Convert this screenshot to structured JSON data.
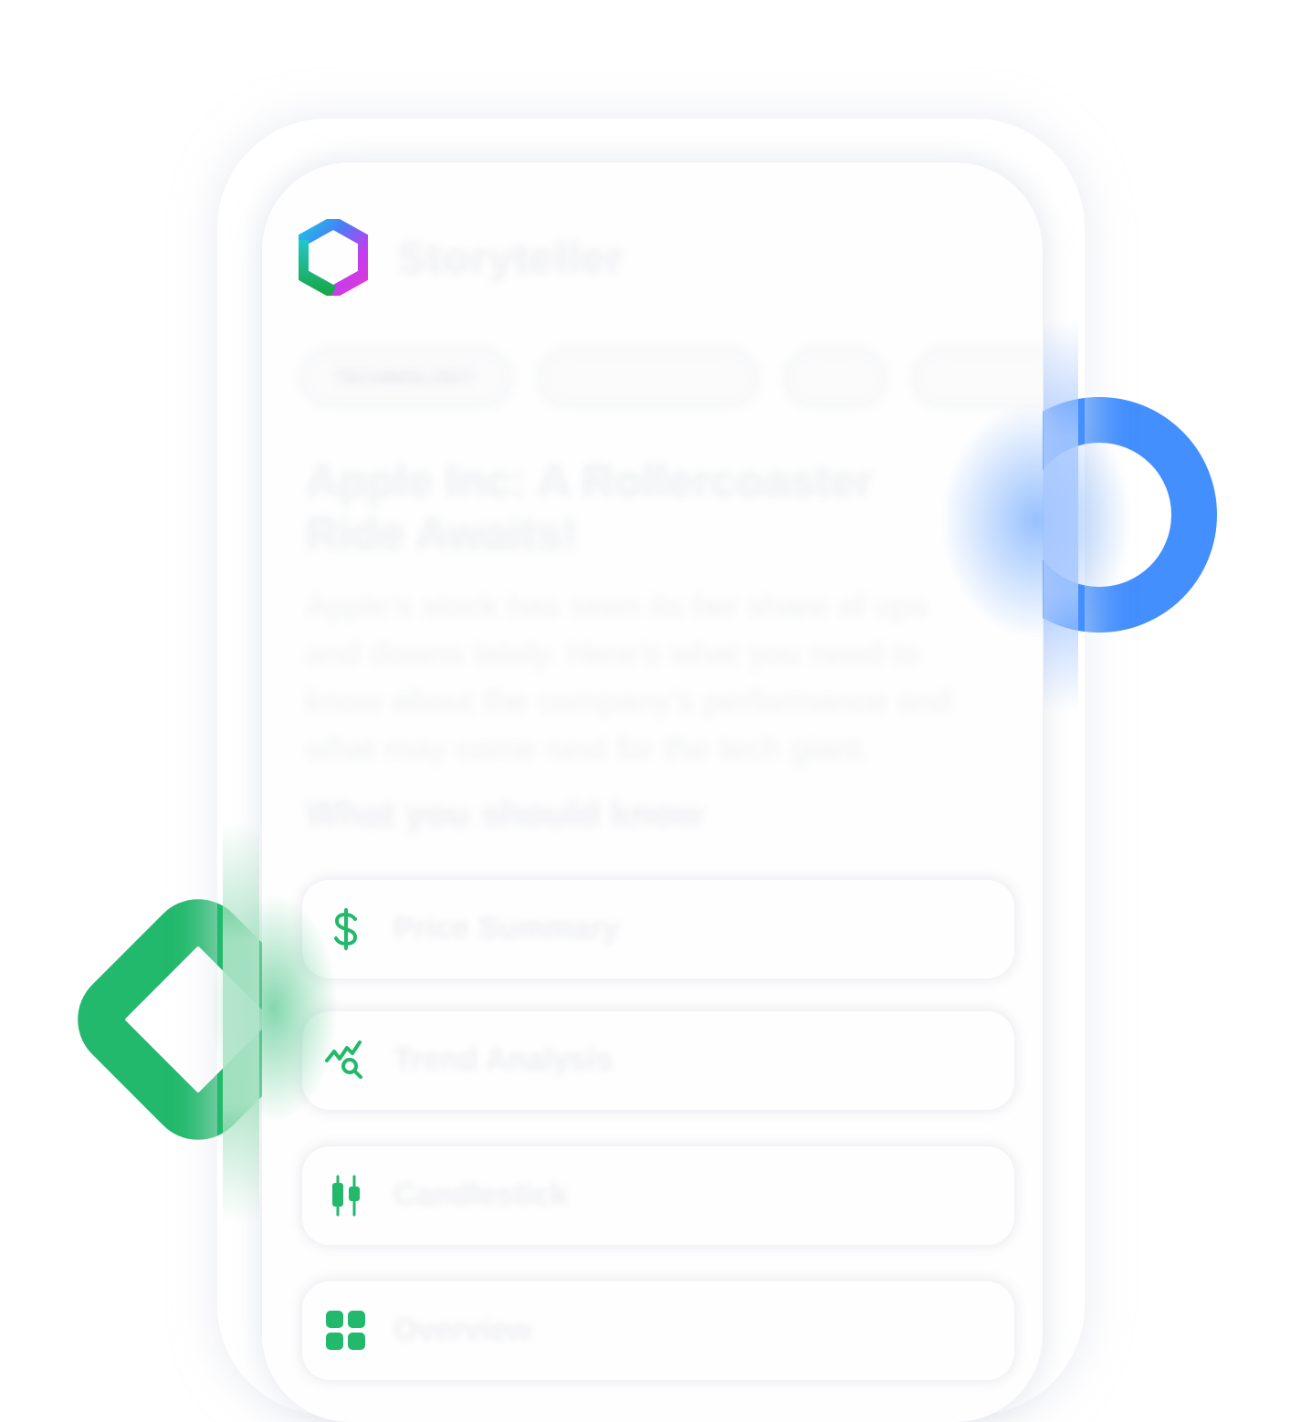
{
  "app": {
    "brand": "Storyteller"
  },
  "tabs": [
    {
      "label": "TECHNOLOGY"
    },
    {
      "label": ""
    },
    {
      "label": ""
    },
    {
      "label": ""
    }
  ],
  "article": {
    "headline": "Apple Inc: A Rollercoaster Ride Awaits!",
    "summary": "Apple's stock has seen its fair share of ups and downs lately. Here's what you need to know about the company's performance and what may come next for the tech giant.",
    "section_heading": "What you should know"
  },
  "cards": [
    {
      "label": "Price Summary",
      "icon": "dollar-icon"
    },
    {
      "label": "Trend Analysis",
      "icon": "trend-search-icon"
    },
    {
      "label": "Candlestick",
      "icon": "candlestick-icon"
    },
    {
      "label": "Overview",
      "icon": "grid-icon"
    }
  ],
  "colors": {
    "accent_green": "#22b96c",
    "accent_blue": "#438ffe",
    "icon_green": "#22b96c"
  }
}
